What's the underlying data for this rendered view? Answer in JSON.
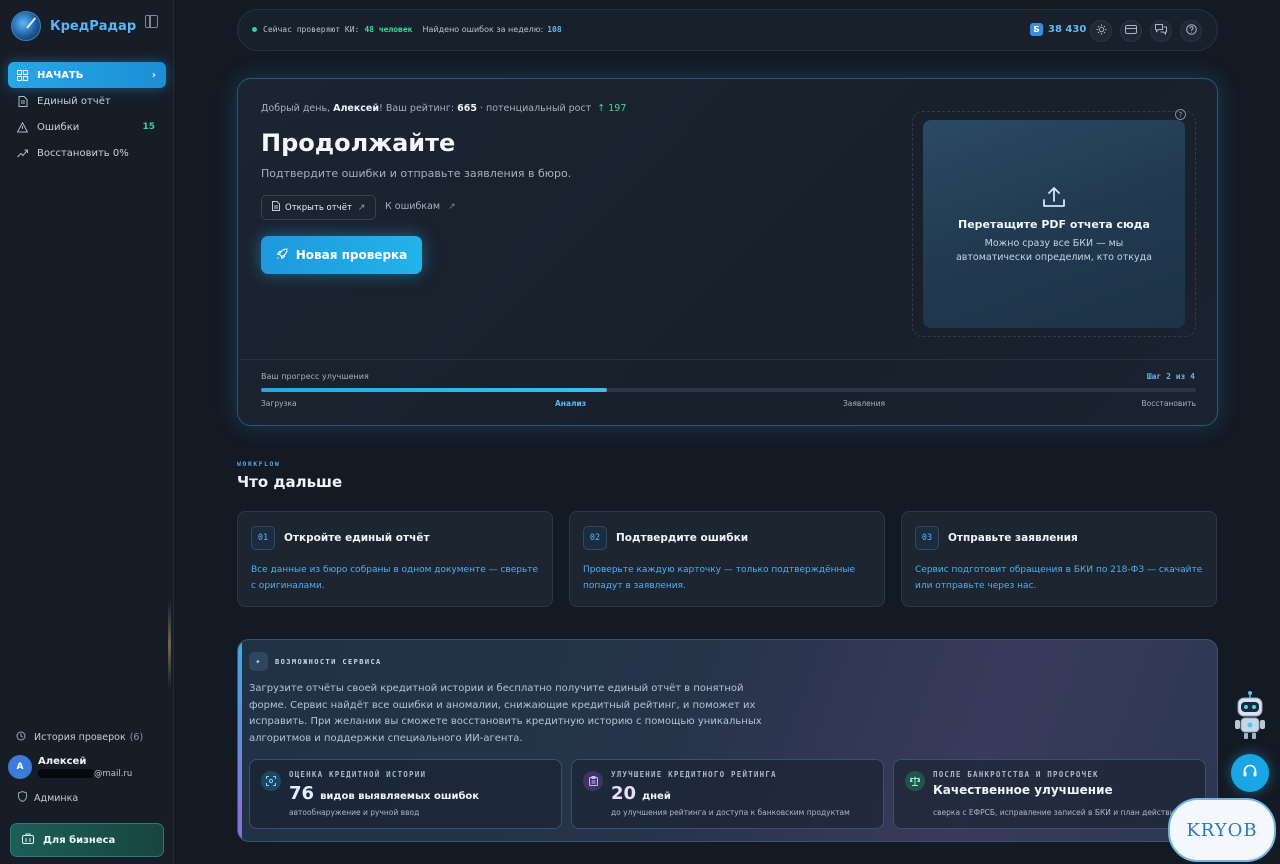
{
  "brand": {
    "name": "КредРадар"
  },
  "sidebar": {
    "items": [
      {
        "label": "НАЧАТЬ",
        "icon": "grid-icon",
        "active": true
      },
      {
        "label": "Единый отчёт",
        "icon": "document-icon"
      },
      {
        "label": "Ошибки",
        "icon": "warning-icon",
        "badge": "15"
      },
      {
        "label": "Восстановить 0%",
        "icon": "trend-up-icon"
      }
    ],
    "history_label": "История проверок",
    "history_count": "(6)",
    "user_initial": "А",
    "user_name": "Алексей",
    "user_mail_suffix": "@mail.ru",
    "admin_label": "Админка",
    "business_label": "Для бизнеса"
  },
  "topbar": {
    "checking_label": "Сейчас проверяют КИ:",
    "checking_value": "48 человек",
    "found_label": "Найдено ошибок за неделю:",
    "found_value": "108",
    "balance_icon": "Б",
    "balance": "38 430"
  },
  "hero": {
    "greet_prefix": "Добрый день, ",
    "user": "Алексей",
    "rating_label": "! Ваш рейтинг: ",
    "rating": "665",
    "growth_label": " · потенциальный рост ",
    "growth": "↑ 197",
    "title": "Продолжайте",
    "subtitle": "Подтвердите ошибки и отправьте заявления в бюро.",
    "open_report": "Открыть отчёт",
    "to_errors": "К ошибкам",
    "new_check": "Новая проверка",
    "drop_title": "Перетащите PDF отчета сюда",
    "drop_text": "Можно сразу все БКИ — мы автоматически определим, кто откуда",
    "progress_label": "Ваш прогресс улучшения",
    "progress_step": "Шаг 2 из 4",
    "progress_fraction": 0.37,
    "steps": [
      "Загрузка",
      "Анализ",
      "Заявления",
      "Восстановить"
    ]
  },
  "workflow": {
    "kicker": "WORKFLOW",
    "title": "Что дальше",
    "cards": [
      {
        "num": "01",
        "title": "Откройте единый отчёт",
        "desc": "Все данные из бюро собраны в одном документе — сверьте с оригиналами."
      },
      {
        "num": "02",
        "title": "Подтвердите ошибки",
        "desc": "Проверьте каждую карточку — только подтверждённые попадут в заявления."
      },
      {
        "num": "03",
        "title": "Отправьте заявления",
        "desc": "Сервис подготовит обращения в БКИ по 218-ФЗ — скачайте или отправьте через нас."
      }
    ]
  },
  "features": {
    "kicker": "ВОЗМОЖНОСТИ СЕРВИСА",
    "text": "Загрузите отчёты своей кредитной истории и бесплатно получите единый отчёт в понятной форме. Сервис найдёт все ошибки и аномалии, снижающие кредитный рейтинг, и поможет их исправить. При желании вы сможете восстановить кредитную историю с помощью уникальных алгоритмов и поддержки специального ИИ-агента.",
    "cards": [
      {
        "label": "ОЦЕНКА КРЕДИТНОЙ ИСТОРИИ",
        "big": "76",
        "unit": "видов выявляемых ошибок",
        "note": "автообнаружение и ручной ввод"
      },
      {
        "label": "УЛУЧШЕНИЕ КРЕДИТНОГО РЕЙТИНГА",
        "big": "20",
        "unit": "дней",
        "note": "до улучшения рейтинга и доступа к банковским продуктам"
      },
      {
        "label": "ПОСЛЕ БАНКРОТСТВА И ПРОСРОЧЕК",
        "head": "Качественное улучшение",
        "note": "сверка с ЕФРСБ, исправление записей в БКИ и план действий"
      }
    ]
  },
  "watermark": "KRYOB",
  "colors": {
    "accent": "#27a7ea",
    "green": "#3ad79e",
    "link": "#4db0ee"
  }
}
